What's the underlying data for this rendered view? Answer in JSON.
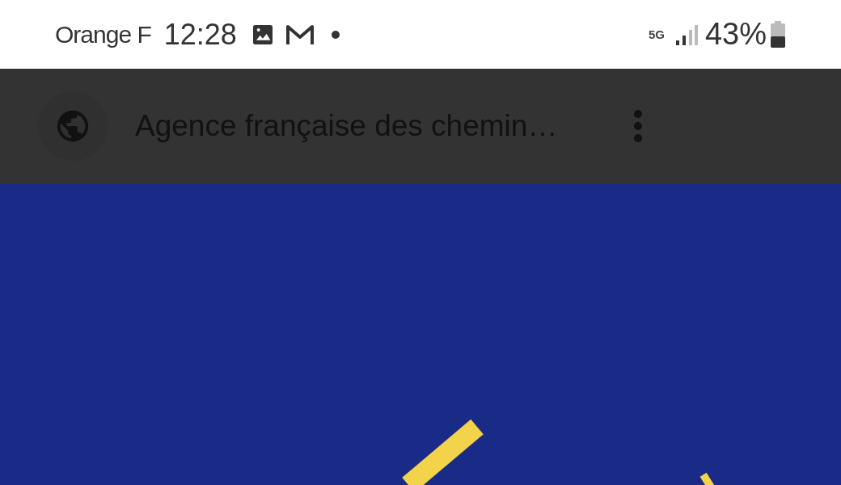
{
  "status_bar": {
    "carrier": "Orange F",
    "time": "12:28",
    "network": "5G",
    "battery": "43%"
  },
  "toolbar": {
    "title": "Agence française des chemin…"
  }
}
